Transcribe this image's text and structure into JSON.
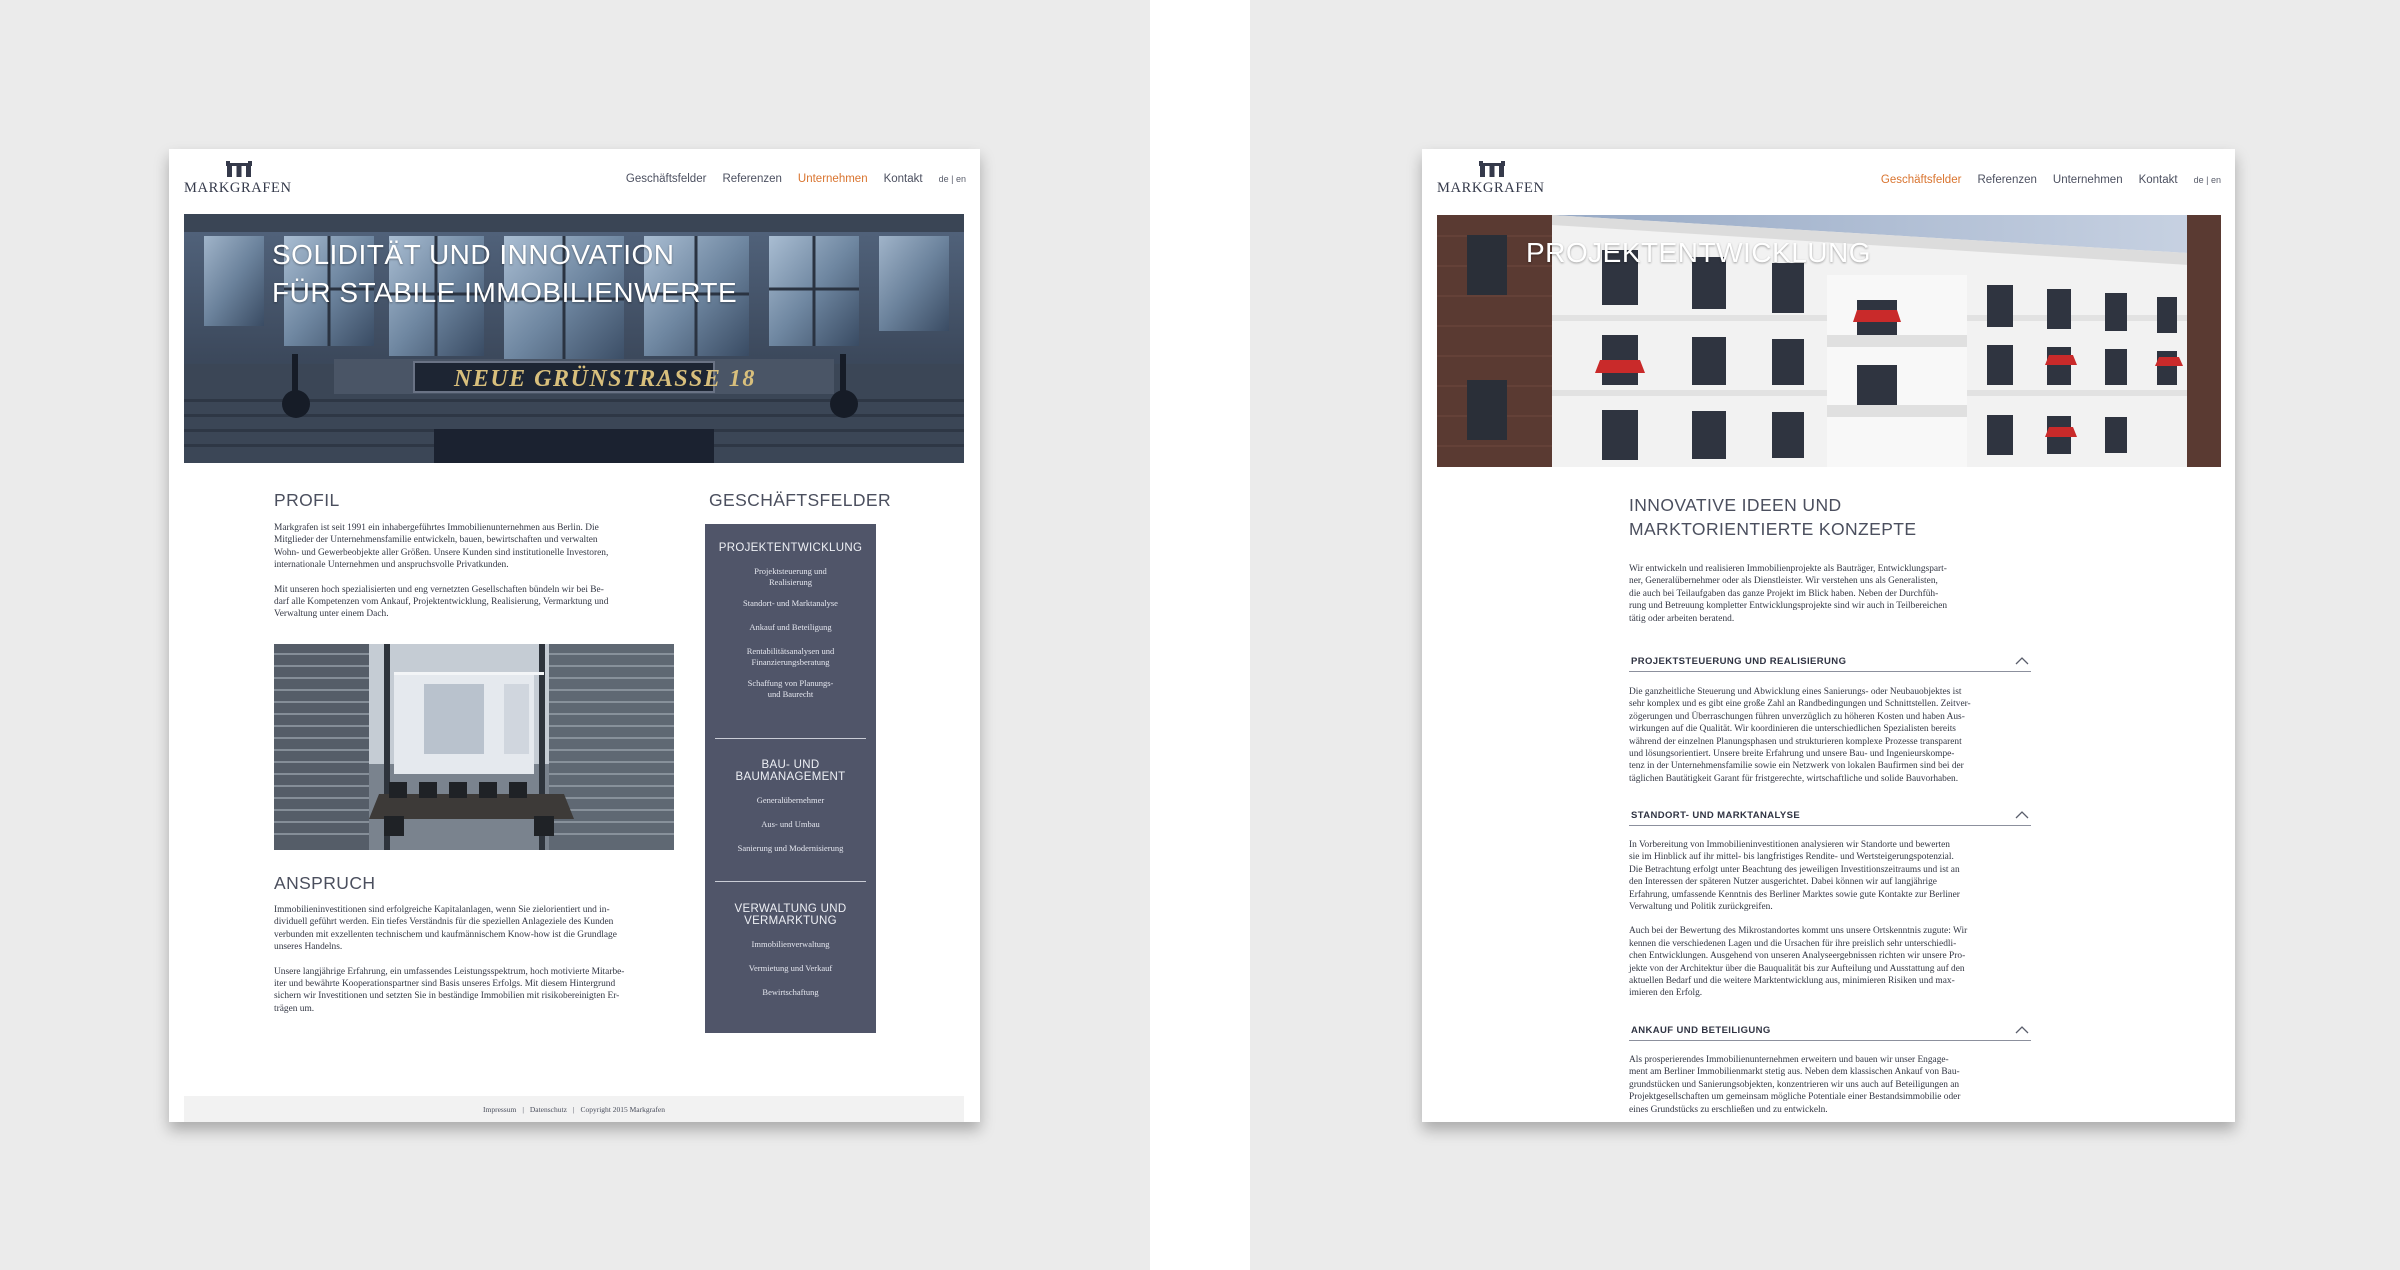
{
  "left_page": {
    "logo_text": "MARKGRAFEN",
    "nav": {
      "items": [
        "Geschäftsfelder",
        "Referenzen",
        "Unternehmen",
        "Kontakt"
      ],
      "active": "Unternehmen",
      "lang_de": "de",
      "lang_sep": "|",
      "lang_en": "en"
    },
    "hero": {
      "title_line1": "SOLIDITÄT UND INNOVATION",
      "title_line2": "FÜR STABILE IMMOBILIENWERTE",
      "sign_text": "NEUE  GRÜNSTRASSE  18"
    },
    "profil": {
      "heading": "PROFIL",
      "p1_lines": [
        "Markgrafen ist seit 1991 ein inhabergeführtes Immobilienunternehmen aus Berlin. Die",
        "Mitglieder der Unternehmensfamilie entwickeln, bauen, bewirtschaften und verwalten",
        "Wohn- und Gewerbeobjekte aller Größen. Unsere Kunden sind institutionelle Investoren,",
        "internationale Unternehmen und anspruchsvolle Privatkunden."
      ],
      "p2_lines": [
        "Mit unseren hoch spezialisierten und eng vernetzten Gesellschaften bündeln wir bei Be-",
        "darf alle Kompetenzen vom Ankauf, Projektentwicklung, Realisierung, Vermarktung und",
        "Verwaltung unter einem Dach."
      ]
    },
    "anspruch": {
      "heading": "ANSPRUCH",
      "p1_lines": [
        "Immobilieninvestitionen sind erfolgreiche Kapitalanlagen, wenn Sie zielorientiert und in-",
        "dividuell geführt werden. Ein tiefes Verständnis für die speziellen Anlageziele des Kunden",
        "verbunden mit exzellenten technischem und kaufmännischem Know-how ist die Grundlage",
        "unseres Handelns."
      ],
      "p2_lines": [
        "Unsere langjährige Erfahrung, ein umfassendes Leistungsspektrum, hoch motivierte Mitarbe-",
        "iter und bewährte Kooperationspartner sind Basis unseres Erfolgs. Mit diesem Hintergrund",
        "sichern wir Investitionen und setzten Sie in beständige Immobilien mit risikobereinigten Er-",
        "trägen um."
      ]
    },
    "geschaeftsfelder": {
      "heading": "GESCHÄFTSFELDER",
      "groups": [
        {
          "title_lines": [
            "PROJEKTENTWICKLUNG"
          ],
          "items": [
            [
              "Projektsteuerung und",
              "Realisierung"
            ],
            [
              "Standort- und Marktanalyse"
            ],
            [
              "Ankauf und Beteiligung"
            ],
            [
              "Rentabilitätsanalysen und",
              "Finanzierungsberatung"
            ],
            [
              "Schaffung von Planungs-",
              "und Baurecht"
            ]
          ]
        },
        {
          "title_lines": [
            "BAU- UND",
            "BAUMANAGEMENT"
          ],
          "items": [
            [
              "Generalübernehmer"
            ],
            [
              "Aus- und Umbau"
            ],
            [
              "Sanierung und Modernisierung"
            ]
          ]
        },
        {
          "title_lines": [
            "VERWALTUNG UND",
            "VERMARKTUNG"
          ],
          "items": [
            [
              "Immobilienverwaltung"
            ],
            [
              "Vermietung und Verkauf"
            ],
            [
              "Bewirtschaftung"
            ]
          ]
        }
      ]
    },
    "footer": {
      "impressum": "Impressum",
      "sep": "|",
      "datenschutz": "Datenschutz",
      "copyright": "Copyright 2015 Markgrafen"
    }
  },
  "right_page": {
    "logo_text": "MARKGRAFEN",
    "nav": {
      "items": [
        "Geschäftsfelder",
        "Referenzen",
        "Unternehmen",
        "Kontakt"
      ],
      "active": "Geschäftsfelder",
      "lang_de": "de",
      "lang_sep": "|",
      "lang_en": "en"
    },
    "hero": {
      "title": "PROJEKTENTWICKLUNG"
    },
    "intro": {
      "heading_line1": "INNOVATIVE IDEEN UND",
      "heading_line2": "MARKTORIENTIERTE KONZEPTE",
      "lines": [
        "Wir entwickeln und realisieren Immobilienprojekte als Bauträger, Entwicklungspart-",
        "ner, Generalübernehmer oder als Dienstleister. Wir verstehen uns als Generalisten,",
        "die auch bei Teilaufgaben das ganze Projekt im Blick haben. Neben der Durchfüh-",
        "rung und Betreuung kompletter Entwicklungsprojekte sind wir auch in Teilbereichen",
        "tätig oder arbeiten beratend."
      ]
    },
    "accordion": [
      {
        "title": "PROJEKTSTEUERUNG UND REALISIERUNG",
        "paragraphs": [
          [
            "Die ganzheitliche Steuerung und Abwicklung eines Sanierungs- oder Neubauobjektes ist",
            "sehr komplex und es gibt eine große Zahl an Randbedingungen und Schnittstellen. Zeitver-",
            "zögerungen und Überraschungen führen unverzüglich zu höheren Kosten und haben Aus-",
            "wirkungen auf die Qualität. Wir koordinieren die unterschiedlichen Spezialisten bereits",
            "während der einzelnen Planungsphasen und strukturieren komplexe Prozesse transparent",
            "und lösungsorientiert. Unsere breite Erfahrung und unsere Bau- und Ingenieurskompe-",
            "tenz in der Unternehmensfamilie sowie ein Netzwerk von lokalen Baufirmen sind bei der",
            "täglichen Bautätigkeit Garant für fristgerechte, wirtschaftliche und solide Bauvorhaben."
          ]
        ]
      },
      {
        "title": "STANDORT- UND MARKTANALYSE",
        "paragraphs": [
          [
            "In Vorbereitung von Immobilieninvestitionen analysieren wir Standorte und bewerten",
            "sie im Hinblick auf ihr mittel- bis langfristiges Rendite- und Wertsteigerungspotenzial.",
            "Die Betrachtung erfolgt unter Beachtung des jeweiligen Investitionszeitraums und ist an",
            "den Interessen der späteren Nutzer ausgerichtet. Dabei können wir auf langjährige",
            "Erfahrung, umfassende Kenntnis des Berliner Marktes sowie gute Kontakte zur Berliner",
            "Verwaltung und Politik zurückgreifen."
          ],
          [
            "Auch bei der Bewertung des Mikrostandortes kommt uns unsere Ortskenntnis zugute: Wir",
            "kennen die verschiedenen Lagen und die Ursachen für ihre preislich sehr unterschiedli-",
            "chen Entwicklungen. Ausgehend von unseren Analyseergebnissen richten wir unsere Pro-",
            "jekte von der Architektur über die Bauqualität bis zur Aufteilung und Ausstattung auf den",
            "aktuellen Bedarf und die weitere Marktentwicklung aus, minimieren Risiken und max-",
            "imieren den Erfolg."
          ]
        ]
      },
      {
        "title": "ANKAUF UND BETEILIGUNG",
        "paragraphs": [
          [
            "Als prosperierendes Immobilienunternehmen erweitern und bauen wir unser Engage-",
            "ment am Berliner Immobilienmarkt stetig aus. Neben dem klassischen Ankauf von Bau-",
            "grundstücken und Sanierungsobjekten, konzentrieren wir uns auch auf Beteiligungen an",
            "Projektgesellschaften um gemeinsam mögliche Potentiale einer Bestandsimmobilie oder",
            "eines Grundstücks zu erschließen und zu entwickeln."
          ]
        ]
      }
    ]
  }
}
